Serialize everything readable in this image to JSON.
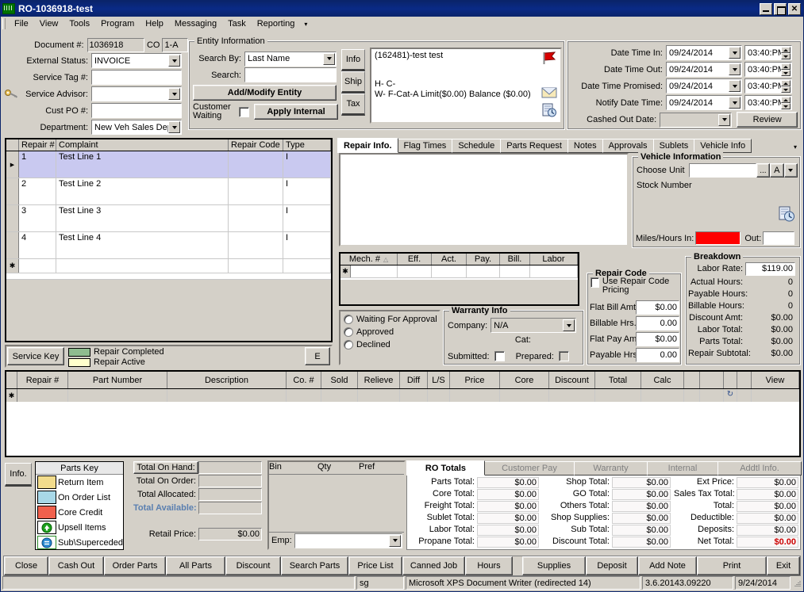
{
  "window": {
    "title": "RO-1036918-test",
    "icon": "app-icon",
    "minimize": "_",
    "maximize": "□",
    "close": "✕"
  },
  "menubar": {
    "items": [
      "File",
      "View",
      "Tools",
      "Program",
      "Help",
      "Messaging",
      "Task",
      "Reporting"
    ],
    "overflow": "▾"
  },
  "document": {
    "labels": {
      "document_no": "Document #:",
      "co": "CO",
      "external_status": "External Status:",
      "service_tag": "Service Tag #:",
      "service_advisor": "Service Advisor:",
      "cust_po": "Cust PO #:",
      "department": "Department:"
    },
    "values": {
      "document_no": "1036918",
      "co": "1-A",
      "external_status": "INVOICE",
      "service_tag": "",
      "service_advisor": "",
      "cust_po": "",
      "department": "New Veh Sales Dep"
    }
  },
  "entity": {
    "title": "Entity Information",
    "search_by_label": "Search By:",
    "search_by_value": "Last Name",
    "search_label": "Search:",
    "search_value": "",
    "add_modify_button": "Add/Modify Entity",
    "customer_waiting_label": "Customer Waiting",
    "customer_waiting_checked": false,
    "apply_internal_button": "Apply Internal",
    "vtabs": [
      "Info",
      "Ship",
      "Tax"
    ],
    "info_lines": [
      "(162481)-test test",
      "",
      "H- C-",
      "W- F-Cat-A Limit($0.00) Balance ($0.00)"
    ],
    "icons": [
      "flag-icon",
      "envelope-icon",
      "history-icon"
    ]
  },
  "dates": {
    "rows": [
      {
        "label": "Date Time In:",
        "date": "09/24/2014",
        "time": "03:40:PM"
      },
      {
        "label": "Date Time Out:",
        "date": "09/24/2014",
        "time": "03:40:PM"
      },
      {
        "label": "Date Time Promised:",
        "date": "09/24/2014",
        "time": "03:40:PM"
      },
      {
        "label": "Notify Date Time:",
        "date": "09/24/2014",
        "time": "03:40:PM"
      }
    ],
    "cashed_out_label": "Cashed Out Date:",
    "cashed_out_value": "",
    "review_button": "Review"
  },
  "repair_grid": {
    "columns": [
      "Repair #",
      "Complaint",
      "Repair Code",
      "Type"
    ],
    "rows": [
      {
        "num": "1",
        "complaint": "Test Line 1",
        "code": "",
        "type": "I",
        "selected": true
      },
      {
        "num": "2",
        "complaint": "Test Line 2",
        "code": "",
        "type": "I",
        "selected": false
      },
      {
        "num": "3",
        "complaint": "Test Line 3",
        "code": "",
        "type": "I",
        "selected": false
      },
      {
        "num": "4",
        "complaint": "Test Line 4",
        "code": "",
        "type": "I",
        "selected": false
      }
    ],
    "new_row_marker": "✱",
    "current_row_marker": "▶"
  },
  "service_key": {
    "button": "Service Key",
    "legend": [
      {
        "label": "Repair Completed",
        "color": "#8fbc8f"
      },
      {
        "label": "Repair Active",
        "color": "#ffffcc"
      }
    ],
    "edge_button": "E"
  },
  "repair_tabs": {
    "items": [
      "Repair Info.",
      "Flag Times",
      "Schedule",
      "Parts Request",
      "Notes",
      "Approvals",
      "Sublets",
      "Vehicle Info"
    ],
    "active": "Repair Info.",
    "overflow": "▾"
  },
  "complaint_text": "",
  "vehicle": {
    "title": "Vehicle Information",
    "choose_unit_label": "Choose Unit",
    "choose_unit_value": "",
    "ellipsis_button": "...",
    "a_button": "A",
    "stock_number_label": "Stock Number",
    "stock_number_value": "",
    "miles_in_label": "Miles/Hours In:",
    "miles_in_value": "",
    "miles_out_label": "Out:",
    "miles_out_value": "",
    "history_icon": "history-icon"
  },
  "mech_grid": {
    "columns": [
      "Mech. #",
      "Eff.",
      "Act.",
      "Pay.",
      "Bill.",
      "Labor"
    ],
    "sort_indicator": "△",
    "new_row_marker": "✱",
    "rows": []
  },
  "approval": {
    "options": [
      "Waiting For Approval",
      "Approved",
      "Declined"
    ],
    "selected": null
  },
  "warranty": {
    "title": "Warranty Info",
    "company_label": "Company:",
    "company_value": "N/A",
    "cat_label": "Cat:",
    "cat_value": "",
    "submitted_label": "Submitted:",
    "submitted_checked": false,
    "prepared_label": "Prepared:",
    "prepared_checked": false
  },
  "repair_code": {
    "title": "Repair Code",
    "use_pricing_label": "Use Repair Code Pricing",
    "use_pricing_checked": false,
    "fields": [
      {
        "label": "Flat Bill Amt:",
        "value": "$0.00"
      },
      {
        "label": "Billable Hrs.:",
        "value": "0.00"
      },
      {
        "label": "Flat Pay Amt:",
        "value": "$0.00"
      },
      {
        "label": "Payable Hrs.:",
        "value": "0.00"
      }
    ]
  },
  "breakdown": {
    "title": "Breakdown",
    "labor_rate_label": "Labor Rate:",
    "labor_rate_value": "$119.00",
    "rows": [
      {
        "label": "Actual Hours:",
        "value": "0"
      },
      {
        "label": "Payable Hours:",
        "value": "0"
      },
      {
        "label": "Billable Hours:",
        "value": "0"
      },
      {
        "label": "Discount Amt:",
        "value": "$0.00"
      },
      {
        "label": "Labor Total:",
        "value": "$0.00"
      },
      {
        "label": "Parts Total:",
        "value": "$0.00"
      },
      {
        "label": "Repair Subtotal:",
        "value": "$0.00"
      }
    ]
  },
  "parts_grid": {
    "columns": [
      "Repair #",
      "Part Number",
      "Description",
      "Co. #",
      "Sold",
      "Relieve",
      "Diff",
      "L/S",
      "Price",
      "Core",
      "Discount",
      "Total",
      "Calc",
      "",
      "",
      "",
      "",
      "View"
    ],
    "new_row_marker": "✱",
    "refresh_icon": "refresh-icon",
    "rows": []
  },
  "info_tab": {
    "label": "Info."
  },
  "parts_key": {
    "title": "Parts Key",
    "items": [
      {
        "label": "Return Item",
        "color": "#f2dc8c",
        "icon": ""
      },
      {
        "label": "On Order List",
        "color": "#a8d8e8",
        "icon": ""
      },
      {
        "label": "Core Credit",
        "color": "#f0604d",
        "icon": ""
      },
      {
        "label": "Upsell Items",
        "color": "#ffffff",
        "icon": "up-arrow-icon"
      },
      {
        "label": "Sub\\Superceded",
        "color": "#ffffff",
        "icon": "sub-icon"
      }
    ]
  },
  "totals_left": {
    "rows": [
      {
        "label": "Total On Hand:",
        "value": ""
      },
      {
        "label": "Total On Order:",
        "value": ""
      },
      {
        "label": "Total Allocated:",
        "value": ""
      },
      {
        "label": "Total Available:",
        "value": ""
      }
    ],
    "retail_price_label": "Retail Price:",
    "retail_price_value": "$0.00"
  },
  "bin_grid": {
    "columns": [
      "Bin",
      "Qty",
      "Pref"
    ],
    "rows": [],
    "emp_label": "Emp:",
    "emp_value": ""
  },
  "ro_totals": {
    "tabs": [
      "RO Totals",
      "Customer Pay",
      "Warranty",
      "Internal",
      "Addtl Info."
    ],
    "active": "RO Totals",
    "col1": [
      {
        "label": "Parts Total:",
        "value": "$0.00"
      },
      {
        "label": "Core Total:",
        "value": "$0.00"
      },
      {
        "label": "Freight Total:",
        "value": "$0.00"
      },
      {
        "label": "Sublet Total:",
        "value": "$0.00"
      },
      {
        "label": "Labor Total:",
        "value": "$0.00"
      },
      {
        "label": "Propane Total:",
        "value": "$0.00"
      }
    ],
    "col2": [
      {
        "label": "Shop Total:",
        "value": "$0.00"
      },
      {
        "label": "GO Total:",
        "value": "$0.00"
      },
      {
        "label": "Others Total:",
        "value": "$0.00"
      },
      {
        "label": "Shop Supplies:",
        "value": "$0.00"
      },
      {
        "label": "Sub Total:",
        "value": "$0.00"
      },
      {
        "label": "Discount Total:",
        "value": "$0.00"
      }
    ],
    "col3": [
      {
        "label": "Ext Price:",
        "value": "$0.00"
      },
      {
        "label": "Sales Tax Total:",
        "value": "$0.00"
      },
      {
        "label": "Total:",
        "value": "$0.00"
      },
      {
        "label": "Deductible:",
        "value": "$0.00"
      },
      {
        "label": "Deposits:",
        "value": "$0.00"
      },
      {
        "label": "Net Total:",
        "value": "$0.00",
        "emphasis": "red"
      }
    ]
  },
  "action_bar": {
    "buttons": [
      "Close",
      "Cash Out",
      "Order Parts",
      "All Parts",
      "Discount",
      "Search Parts",
      "Price List",
      "Canned Job",
      "Hours",
      "Supplies",
      "Deposit",
      "Add Note",
      "Print",
      "Exit"
    ]
  },
  "statusbar": {
    "message": "",
    "user": "sg",
    "printer": "Microsoft XPS Document Writer (redirected 14)",
    "version": "3.6.20143.09220",
    "date": "9/24/2014"
  },
  "colors": {
    "accent": "#0a246a",
    "face": "#d4d0c8",
    "selection": "#c9c9f0",
    "alert": "#ff0000",
    "total_available_label": "#5a7fb0"
  }
}
